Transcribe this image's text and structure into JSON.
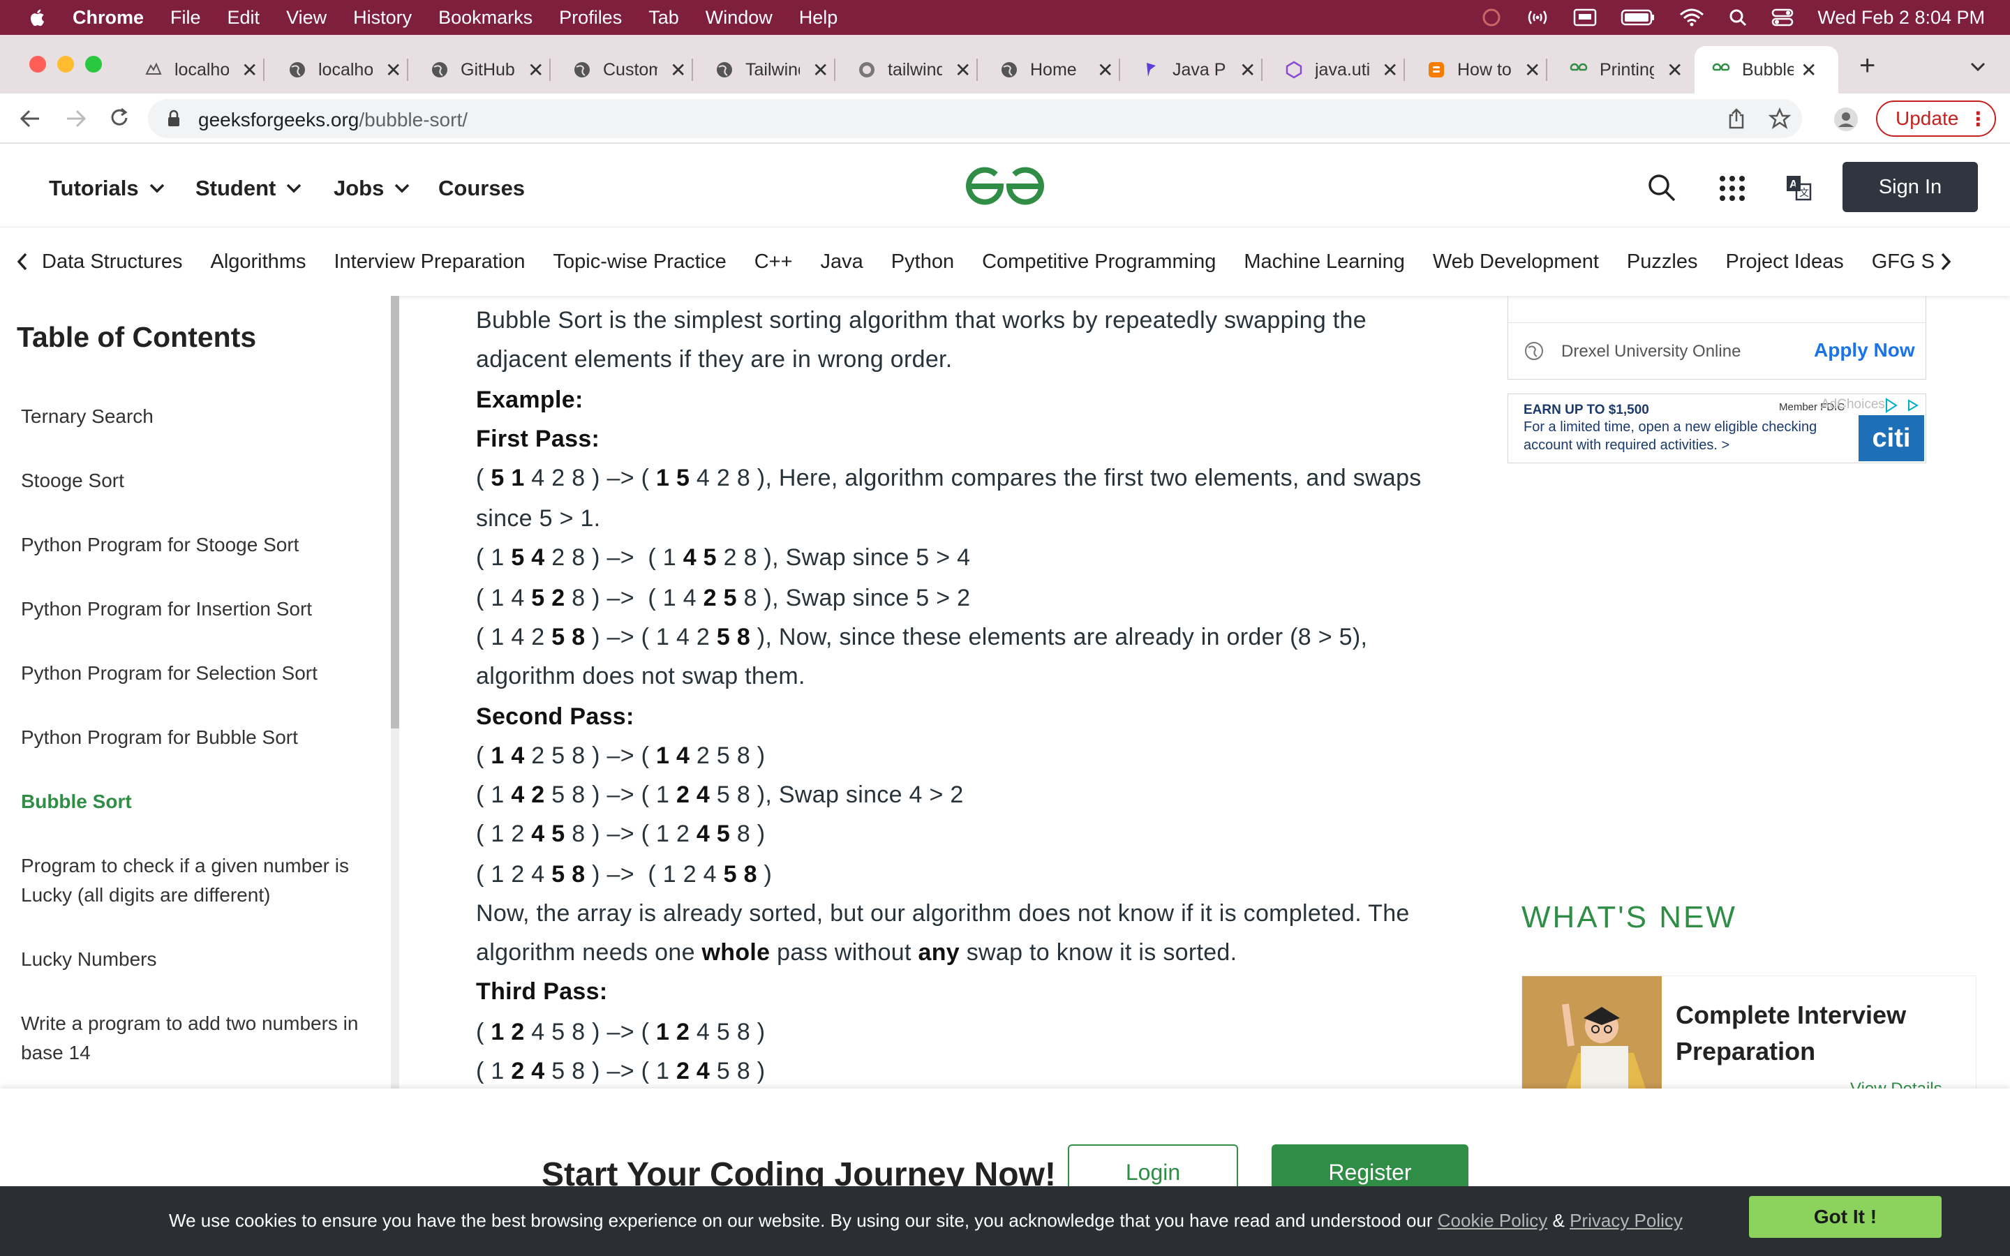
{
  "menubar": {
    "app": "Chrome",
    "items": [
      "File",
      "Edit",
      "View",
      "History",
      "Bookmarks",
      "Profiles",
      "Tab",
      "Window",
      "Help"
    ],
    "datetime": "Wed Feb 2  8:04 PM"
  },
  "tabs": [
    {
      "title": "localhost",
      "favicon": "aws-icon"
    },
    {
      "title": "localhost",
      "favicon": "globe-icon"
    },
    {
      "title": "GitHub",
      "favicon": "globe-icon"
    },
    {
      "title": "Custom",
      "favicon": "globe-icon"
    },
    {
      "title": "Tailwind",
      "favicon": "globe-icon"
    },
    {
      "title": "tailwind",
      "favicon": "globe-icon"
    },
    {
      "title": "Home",
      "favicon": "globe-icon"
    },
    {
      "title": "Java P",
      "favicon": "p-logo-icon"
    },
    {
      "title": "java.util",
      "favicon": "hexagon-icon"
    },
    {
      "title": "How to",
      "favicon": "blogger-icon"
    },
    {
      "title": "Printing",
      "favicon": "gfg-icon"
    },
    {
      "title": "Bubble",
      "favicon": "gfg-icon",
      "active": true
    }
  ],
  "address": {
    "domain": "geeksforgeeks.org",
    "path": "/bubble-sort/",
    "update_label": "Update"
  },
  "header": {
    "nav": [
      "Tutorials",
      "Student",
      "Jobs",
      "Courses"
    ],
    "signin": "Sign In",
    "brand_color": "#2f8d46"
  },
  "categories": [
    "Data Structures",
    "Algorithms",
    "Interview Preparation",
    "Topic-wise Practice",
    "C++",
    "Java",
    "Python",
    "Competitive Programming",
    "Machine Learning",
    "Web Development",
    "Puzzles",
    "Project Ideas",
    "GFG S"
  ],
  "toc": {
    "title": "Table of Contents",
    "items": [
      "Ternary Search",
      "Stooge Sort",
      "Python Program for Stooge Sort",
      "Python Program for Insertion Sort",
      "Python Program for Selection Sort",
      "Python Program for Bubble Sort",
      "Bubble Sort",
      "Program to check if a given number is Lucky (all digits are different)",
      "Lucky Numbers",
      "Write a program to add two numbers in base 14"
    ],
    "active_index": 6
  },
  "article": {
    "intro1": "Bubble Sort is the simplest sorting algorithm that works by repeatedly swapping the",
    "intro2": "adjacent elements if they are in wrong order.",
    "example": "Example:",
    "first_pass": "First Pass:",
    "p1a": ", Here, algorithm compares the first two elements, and swaps",
    "p1b": "since 5 > 1.",
    "p2": ", Swap since 5 > 4",
    "p3": ", Swap since 5 > 2",
    "p4": ", Now, since these elements are already in order (8 > 5),",
    "p4b": "algorithm does not swap them.",
    "second_pass": "Second Pass:",
    "s2": ", Swap since 4 > 2",
    "note1a": "Now, the array is already sorted, but our algorithm does not know if it is completed. The",
    "note2a": "algorithm needs one ",
    "note2b": "whole",
    "note2c": " pass without ",
    "note2d": "any",
    "note2e": " swap to know it is sorted.",
    "third_pass": "Third Pass:"
  },
  "ads": {
    "ad1_org": "Drexel University Online",
    "ad1_cta": "Apply Now",
    "ad2_headline": "EARN UP TO $1,500",
    "ad2_line1": "For a limited time, open a new eligible checking",
    "ad2_line2": "account with required activities. >",
    "ad2_member": "Member FDIC",
    "ad2_brand": "citi",
    "ad2_choices": "AdChoices"
  },
  "whats_new": {
    "title": "WHAT'S NEW",
    "card_title": "Complete Interview Preparation",
    "card_link": "View Details"
  },
  "journey": {
    "text": "Start Your Coding Journey Now!",
    "login": "Login",
    "register": "Register"
  },
  "cookie": {
    "text": "We use cookies to ensure you have the best browsing experience on our website. By using our site, you acknowledge that you have read and understood our ",
    "cookie_policy": "Cookie Policy",
    "amp": " & ",
    "privacy_policy": "Privacy Policy",
    "button": "Got It !"
  }
}
